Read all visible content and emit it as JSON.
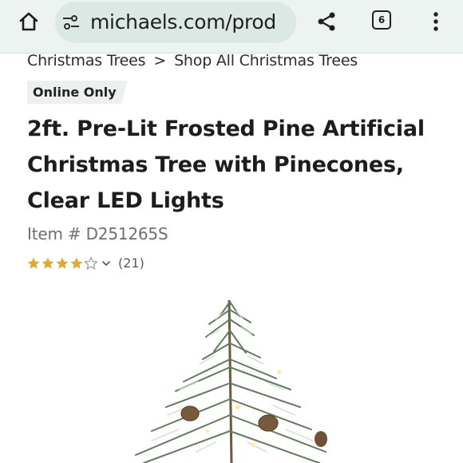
{
  "browser": {
    "url": "michaels.com/prod",
    "tab_count": "6",
    "icons": [
      "home-icon",
      "page-info-icon",
      "share-icon",
      "tabs-icon",
      "more-vert-icon"
    ]
  },
  "breadcrumb": {
    "items": [
      "Christmas Trees",
      "Shop All Christmas Trees"
    ],
    "separator": ">"
  },
  "badge": "Online Only",
  "product": {
    "title": "2ft. Pre-Lit Frosted Pine Artificial Christmas Tree with Pinecones, Clear LED Lights",
    "item_number": "Item # D251265S",
    "rating": 4,
    "rating_max": 5,
    "review_count": "(21)"
  },
  "colors": {
    "toolbar_bg": "#ecf3f0",
    "url_bg": "#dce8e3",
    "star_filled": "#e2a834",
    "star_empty": "#9a9a9a"
  }
}
